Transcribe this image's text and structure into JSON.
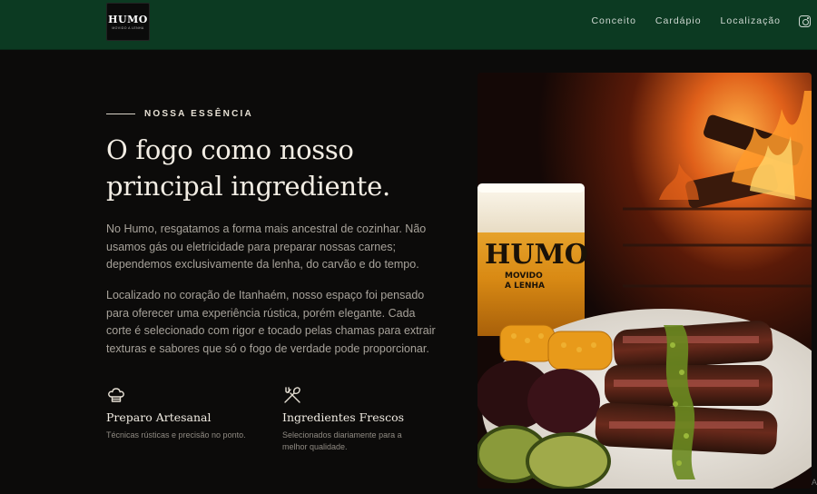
{
  "header": {
    "logo_word": "HUMO",
    "logo_subtitle": "MOVIDO A LENHA",
    "nav": [
      "Conceito",
      "Cardápio",
      "Localização"
    ],
    "icon": "instagram-icon"
  },
  "hero": {
    "eyebrow": "NOSSA ESSÊNCIA",
    "headline_lines": [
      "O fogo como nosso",
      "principal ingrediente."
    ],
    "paragraph1_lines": [
      "No Humo, resgatamos a forma mais ancestral de cozinhar. Não",
      "usamos gás ou eletricidade para preparar nossas carnes;",
      "dependemos exclusivamente da lenha, do carvão e do tempo."
    ],
    "paragraph2_lines": [
      "Localizado no coração de Itanhaém, nosso espaço foi pensado",
      "para oferecer uma experiência rústica, porém elegante. Cada",
      "corte é selecionado com rigor e tocado pelas chamas para extrair",
      "texturas e sabores que só o fogo de verdade pode proporcionar."
    ],
    "features": [
      {
        "icon": "chef-hat-icon",
        "title": "Preparo Artesanal",
        "desc_lines": [
          "Técnicas rústicas e precisão no ponto."
        ]
      },
      {
        "icon": "utensils-icon",
        "title": "Ingredientes Frescos",
        "desc_lines": [
          "Selecionados diariamente para a",
          "melhor qualidade."
        ]
      }
    ]
  },
  "photo": {
    "glass_brand": "HUMO",
    "glass_tagline_lines": [
      "MOVIDO",
      "A LENHA"
    ]
  },
  "corner_text": "A"
}
